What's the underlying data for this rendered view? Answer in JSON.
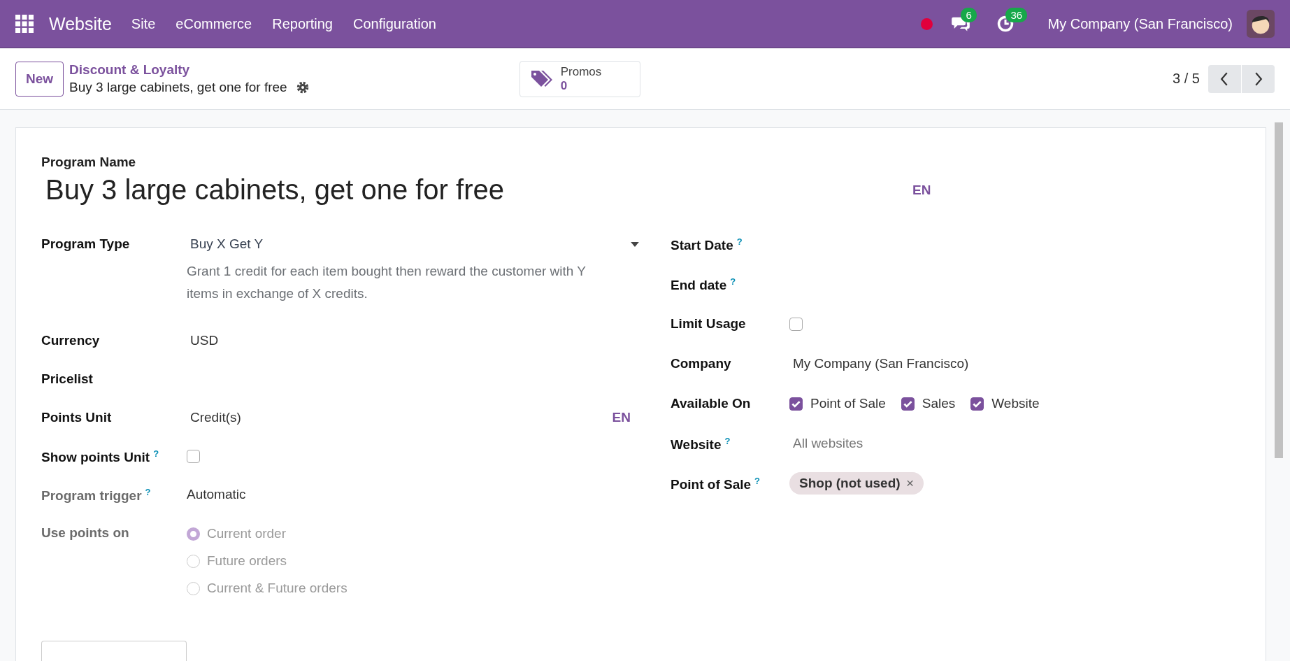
{
  "navbar": {
    "app": "Website",
    "menus": [
      "Site",
      "eCommerce",
      "Reporting",
      "Configuration"
    ],
    "messages_count": "6",
    "activities_count": "36",
    "company": "My Company (San Francisco)"
  },
  "control_panel": {
    "new_button": "New",
    "breadcrumb": "Discount & Loyalty",
    "record": "Buy 3 large cabinets, get one for free",
    "smart_button": {
      "label": "Promos",
      "value": "0"
    },
    "pager": "3 / 5"
  },
  "form": {
    "name_label": "Program Name",
    "name": "Buy 3 large cabinets, get one for free",
    "name_lang": "EN",
    "left": [
      {
        "kind": "select",
        "label": "Program Type",
        "value": "Buy X Get Y",
        "help": "Grant 1 credit for each item bought then reward the customer with Y items in exchange of X credits.",
        "disabled": false
      },
      {
        "kind": "text",
        "label": "Currency",
        "value": "USD",
        "disabled": false
      },
      {
        "kind": "text",
        "label": "Pricelist",
        "disabled": false
      },
      {
        "kind": "text",
        "label": "Points Unit",
        "value": "Credit(s)",
        "lang": "EN",
        "disabled": false
      },
      {
        "kind": "checkbox",
        "label": "Show points Unit",
        "help_mark": "?",
        "checked": false,
        "disabled": false
      },
      {
        "kind": "text",
        "label": "Program trigger",
        "help_mark": "?",
        "value": "Automatic",
        "disabled": true
      },
      {
        "kind": "radio",
        "label": "Use points on",
        "disabled": true,
        "options": [
          {
            "label": "Current order",
            "selected": true
          },
          {
            "label": "Future orders",
            "selected": false
          },
          {
            "label": "Current & Future orders",
            "selected": false
          }
        ]
      }
    ],
    "right": [
      {
        "kind": "text",
        "label": "Start Date",
        "help_mark": "?"
      },
      {
        "kind": "text",
        "label": "End date",
        "help_mark": "?"
      },
      {
        "kind": "checkbox",
        "label": "Limit Usage",
        "checked": false
      },
      {
        "kind": "text",
        "label": "Company",
        "value": "My Company (San Francisco)"
      },
      {
        "kind": "checks",
        "label": "Available On",
        "options": [
          {
            "label": "Point of Sale",
            "checked": true
          },
          {
            "label": "Sales",
            "checked": true
          },
          {
            "label": "Website",
            "checked": true
          }
        ]
      },
      {
        "kind": "placeholder",
        "label": "Website",
        "help_mark": "?",
        "placeholder": "All websites"
      },
      {
        "kind": "tags",
        "label": "Point of Sale",
        "help_mark": "?",
        "tags": [
          {
            "label": "Shop (not used)",
            "remove": "×"
          }
        ]
      }
    ]
  }
}
